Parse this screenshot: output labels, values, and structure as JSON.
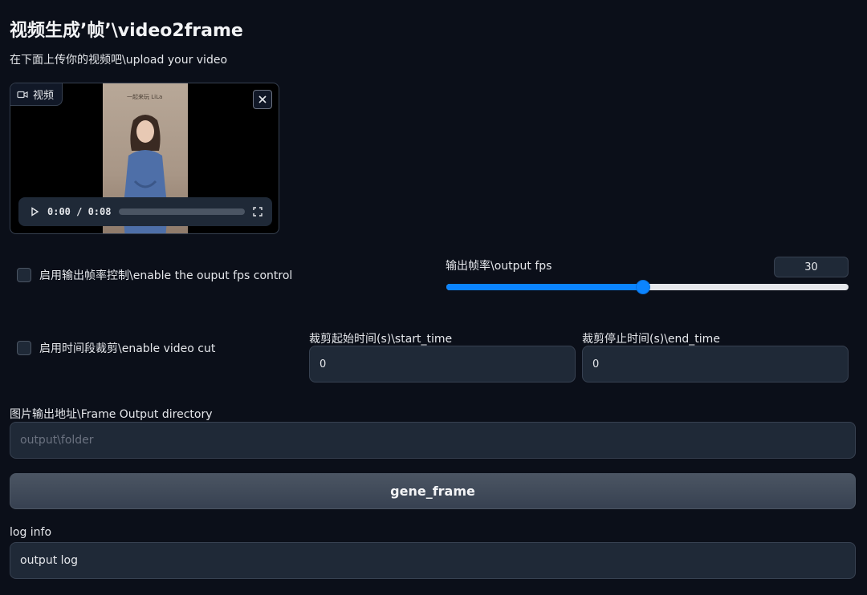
{
  "header": {
    "title": "视频生成’帧’\\video2frame",
    "subtitle": "在下面上传你的视频吧\\upload your video"
  },
  "video": {
    "label": "视频",
    "time": "0:00 / 0:08",
    "progress": 0.0,
    "watermark": "一起来玩 LiLa"
  },
  "fps_control": {
    "checkbox_label": "启用输出帧率控制\\enable the ouput fps control",
    "checked": false,
    "slider_label": "输出帧率\\output fps",
    "value": "30",
    "slider_fraction": 0.49
  },
  "video_cut": {
    "checkbox_label": "启用时间段裁剪\\enable video cut",
    "checked": false,
    "start_label": "裁剪起始时间(s)\\start_time",
    "start_value": "0",
    "end_label": "裁剪停止时间(s)\\end_time",
    "end_value": "0"
  },
  "output_dir": {
    "label": "图片输出地址\\Frame Output directory",
    "placeholder": "output\\folder"
  },
  "action": {
    "button_label": "gene_frame"
  },
  "log": {
    "label": "log info",
    "value": "output log"
  },
  "colors": {
    "background": "#0b0f19",
    "panel": "#1f2937",
    "accent": "#0b84ff"
  }
}
